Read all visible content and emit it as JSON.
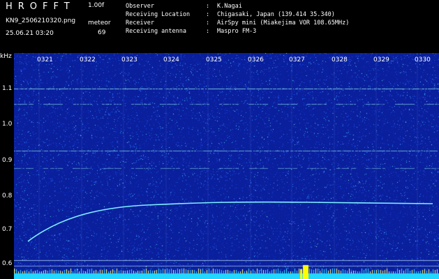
{
  "header": {
    "logo": "HROFFT",
    "version": "1.00f",
    "filename": "KN9_2506210320.png",
    "timestamp": "25.06.21 03:20",
    "meteor_label": "meteor",
    "meteor_count": "69",
    "meta": [
      {
        "key": "Observer",
        "value": "K.Nagai"
      },
      {
        "key": "Receiving Location",
        "value": "Chigasaki, Japan (139.414 35.340)"
      },
      {
        "key": "Receiver",
        "value": "AirSpy mini (Miakejima VOR 108.65MHz)"
      },
      {
        "key": "Receiving antenna",
        "value": "Maspro FM-3"
      }
    ]
  },
  "axis": {
    "y_unit": "kHz",
    "y_ticks": [
      "1.1",
      "1.0",
      "0.9",
      "0.8",
      "0.7",
      "0.6"
    ],
    "x_ticks": [
      "0321",
      "0322",
      "0323",
      "0324",
      "0325",
      "0326",
      "0327",
      "0328",
      "0329",
      "0330"
    ]
  },
  "colors": {
    "background": "#0a1f9c",
    "signal": "#7ff0ff",
    "bottom_bar": "#22d6ff",
    "burst": "#ffff00"
  }
}
